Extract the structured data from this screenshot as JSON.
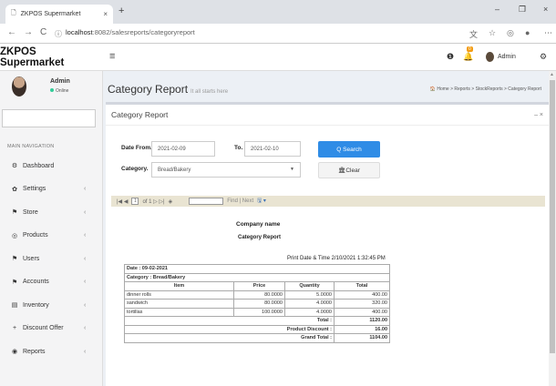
{
  "browser": {
    "tab_title": "ZKPOS Supermarket",
    "tab_close": "×",
    "new_tab": "+",
    "url_host": "localhost",
    "url_path": ":8082/salesreports/categoryreport",
    "back": "←",
    "forward": "→",
    "reload": "C",
    "info": "ⓘ",
    "win_min": "–",
    "win_max": "❐",
    "win_close": "×"
  },
  "header": {
    "logo": "ZKPOS Supermarket",
    "menu_icon": "≡",
    "notif_count": "0",
    "user_name": "Admin"
  },
  "sidebar": {
    "user_name": "Admin",
    "user_status": "Online",
    "nav_heading": "MAIN NAVIGATION",
    "items": [
      {
        "label": "Dashboard",
        "icon": "⚙",
        "chev": ""
      },
      {
        "label": "Settings",
        "icon": "✿",
        "chev": "‹"
      },
      {
        "label": "Store",
        "icon": "⚑",
        "chev": "‹"
      },
      {
        "label": "Products",
        "icon": "◎",
        "chev": "‹"
      },
      {
        "label": "Users",
        "icon": "⚑",
        "chev": "‹"
      },
      {
        "label": "Accounts",
        "icon": "⚑",
        "chev": "‹"
      },
      {
        "label": "Inventory",
        "icon": "▤",
        "chev": "‹"
      },
      {
        "label": "Discount Offer",
        "icon": "+",
        "chev": "‹"
      },
      {
        "label": "Reports",
        "icon": "◉",
        "chev": "‹"
      }
    ]
  },
  "page": {
    "title": "Category Report",
    "subtitle": "It all starts here",
    "breadcrumb": "🏠 Home  >  Reports  >  StockReports  >  Category Report"
  },
  "filter": {
    "box_title": "Category Report",
    "box_tools": "–  ×",
    "date_from_label": "Date From.",
    "date_from": "2021-02-09",
    "to_label": "To.",
    "date_to": "2021-02-10",
    "search_label": "Q Search",
    "category_label": "Category.",
    "category_value": "Bread/Bakery",
    "clear_label": "🏛Clear"
  },
  "report_toolbar": {
    "nav": "|◀  ◀",
    "page": "1",
    "of": "of 1 ▷ ▷|",
    "back": "◈",
    "find_label": "Find | Next",
    "export": "🖫 ▾"
  },
  "report": {
    "company": "Company name",
    "title": "Category Report",
    "print_date": "Print Date & Time  2/10/2021 1:32:45 PM",
    "date_line": "Date : 09-02-2021",
    "category_line": "Category : Bread/Bakery",
    "columns": [
      "Item",
      "Price",
      "Quantity",
      "Total"
    ],
    "rows": [
      [
        "dinner rolls",
        "80.0000",
        "5.0000",
        "400.00"
      ],
      [
        "sandwich",
        "80.0000",
        "4.0000",
        "320.00"
      ],
      [
        "tortillas",
        "100.0000",
        "4.0000",
        "400.00"
      ]
    ],
    "total_label": "Total :",
    "total": "1120.00",
    "discount_label": "Product Discount :",
    "discount": "16.00",
    "grand_label": "Grand Total :",
    "grand": "1104.00"
  }
}
